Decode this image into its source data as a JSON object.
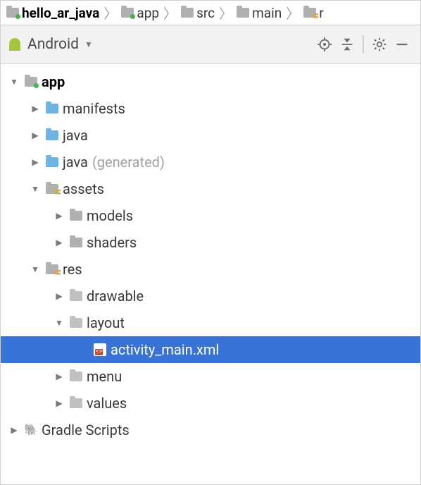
{
  "breadcrumb": {
    "items": [
      {
        "label": "hello_ar_java",
        "bold": true
      },
      {
        "label": "app"
      },
      {
        "label": "src"
      },
      {
        "label": "main"
      },
      {
        "label": "r"
      }
    ]
  },
  "toolbar": {
    "title": "Android"
  },
  "tree": {
    "nodes": {
      "app": "app",
      "manifests": "manifests",
      "java": "java",
      "java_gen": "java",
      "java_gen_suffix": "(generated)",
      "assets": "assets",
      "models": "models",
      "shaders": "shaders",
      "res": "res",
      "drawable": "drawable",
      "layout": "layout",
      "activity_main": "activity_main.xml",
      "menu": "menu",
      "values": "values",
      "gradle": "Gradle Scripts"
    }
  }
}
